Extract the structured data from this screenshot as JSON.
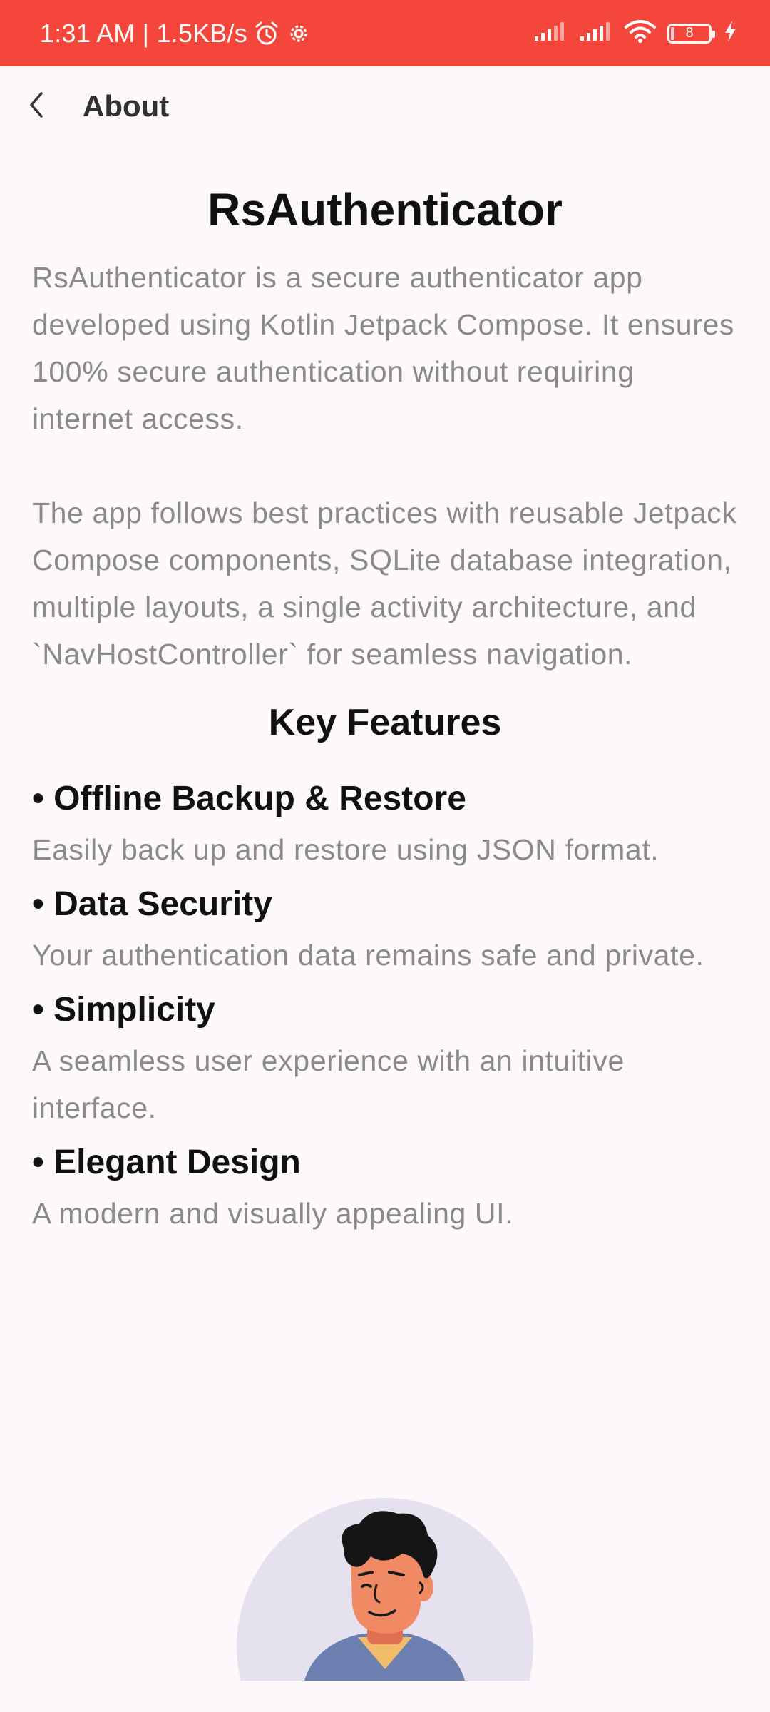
{
  "status_bar": {
    "time_speed": "1:31 AM | 1.5KB/s",
    "battery_level": "8",
    "icons": [
      "alarm-icon",
      "settings-gear-icon",
      "signal-icon",
      "signal-icon",
      "wifi-icon",
      "battery-icon",
      "charging-bolt-icon"
    ]
  },
  "app_bar": {
    "title": "About",
    "back_icon": "chevron-left-icon"
  },
  "content": {
    "app_name": "RsAuthenticator",
    "paragraphs": [
      "RsAuthenticator is a secure authenticator app developed using Kotlin Jetpack Compose. It ensures 100% secure authentication without requiring internet access.",
      "The app follows best practices with reusable Jetpack Compose components, SQLite database integration, multiple layouts, a single activity architecture, and `NavHostController` for seamless navigation."
    ],
    "features_title": "Key Features",
    "features": [
      {
        "title": "• Offline Backup & Restore",
        "description": "Easily back up and restore using JSON format."
      },
      {
        "title": "• Data Security",
        "description": "Your authentication data remains safe and private."
      },
      {
        "title": "• Simplicity",
        "description": "A seamless user experience with an intuitive interface."
      },
      {
        "title": "• Elegant Design",
        "description": "A modern and visually appealing UI."
      }
    ]
  },
  "colors": {
    "status_bar": "#f5463b",
    "background": "#fdf8fc",
    "body_text": "#8a8a8a",
    "heading_text": "#111111",
    "avatar_circle": "#e6e1ef"
  }
}
